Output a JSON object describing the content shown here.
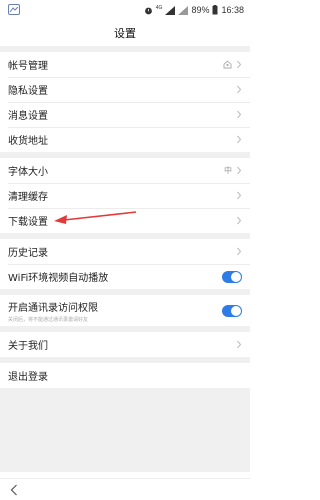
{
  "statusbar": {
    "network": "4G",
    "battery": "89%",
    "time": "16:38"
  },
  "header": {
    "title": "设置"
  },
  "sections": {
    "account": {
      "account_manage": "帐号管理",
      "privacy": "隐私设置",
      "messages": "消息设置",
      "address": "收货地址"
    },
    "general": {
      "font_size": "字体大小",
      "font_size_value": "中",
      "clear_cache": "清理缓存",
      "download": "下载设置",
      "history": "历史记录",
      "wifi_autoplay": "WiFi环境视频自动播放",
      "contacts": "开启通讯录访问权限",
      "contacts_hint": "关闭后，将不能通过通讯录邀请好友"
    },
    "about": {
      "about_us": "关于我们"
    },
    "logout": {
      "label": "退出登录"
    }
  },
  "toggles": {
    "wifi_autoplay_on": true,
    "contacts_on": true
  },
  "icons": {
    "account_row_icon": "user-icon",
    "back": "back-chevron-icon"
  },
  "colors": {
    "accent": "#2e7ce6",
    "annotation_arrow": "#e23a3a",
    "section_gap": "#f0f0f0"
  }
}
